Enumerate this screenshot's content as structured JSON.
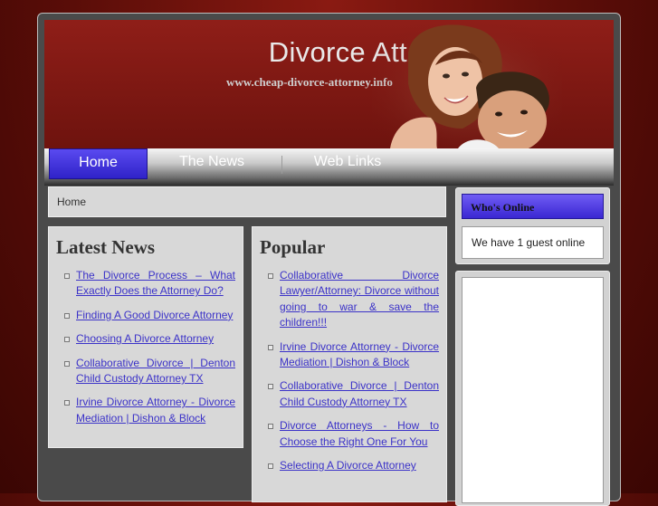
{
  "header": {
    "title": "Divorce Attorney",
    "url": "www.cheap-divorce-attorney.info"
  },
  "nav": {
    "items": [
      {
        "label": "Home",
        "active": true
      },
      {
        "label": "The News"
      },
      {
        "label": "Web Links"
      }
    ]
  },
  "breadcrumb": "Home",
  "latest_news": {
    "title": "Latest News",
    "items": [
      "The Divorce Process – What Exactly Does the Attorney Do?",
      "Finding A Good Divorce Attorney",
      "Choosing A Divorce Attorney",
      "Collaborative Divorce | Denton Child Custody Attorney TX",
      "Irvine Divorce Attorney - Divorce Mediation | Dishon & Block"
    ]
  },
  "popular": {
    "title": "Popular",
    "items": [
      "Collaborative Divorce Lawyer/Attorney: Divorce without going to war & save the children!!!",
      "Irvine Divorce Attorney - Divorce Mediation | Dishon & Block",
      "Collaborative Divorce | Denton Child Custody Attorney TX",
      "Divorce Attorneys - How to Choose the Right One For You",
      "Selecting A Divorce Attorney"
    ]
  },
  "whos_online": {
    "title": "Who's Online",
    "text": "We have 1 guest online"
  },
  "colors": {
    "header_red": "#8f1e18",
    "accent_blue": "#3a27d2",
    "link": "#3b32c8"
  }
}
